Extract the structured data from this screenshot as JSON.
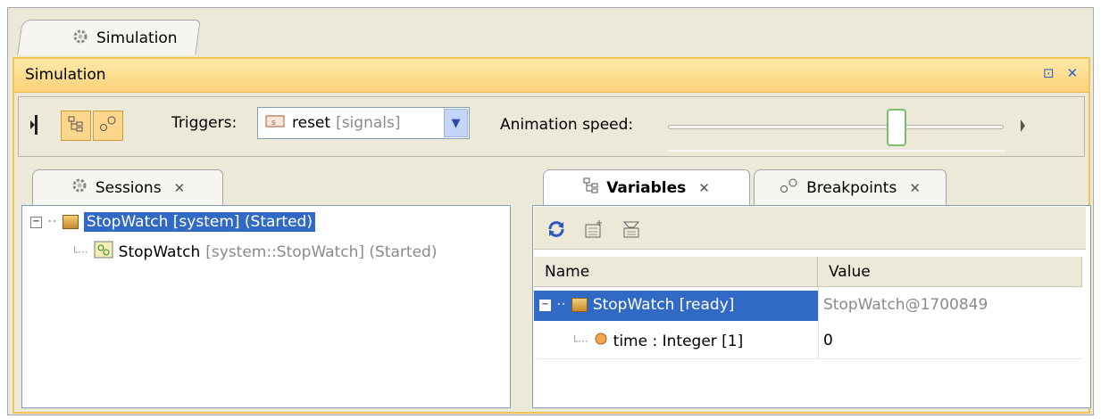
{
  "top_tab": {
    "label": "Simulation"
  },
  "window": {
    "title": "Simulation",
    "restore_glyph": "⊡",
    "close_glyph": "✕"
  },
  "toolbar": {
    "triggers_label": "Triggers:",
    "trigger_value": "reset",
    "trigger_scope": "[signals]",
    "speed_label": "Animation speed:",
    "speed_level": 0.68
  },
  "sessions": {
    "tab_label": "Sessions",
    "items": [
      {
        "name": "StopWatch [system] (Started)",
        "selected": true
      },
      {
        "name": "StopWatch",
        "detail": "[system::StopWatch] (Started)"
      }
    ]
  },
  "variables": {
    "tabs": [
      {
        "label": "Variables",
        "active": true
      },
      {
        "label": "Breakpoints",
        "active": false
      }
    ],
    "columns": [
      "Name",
      "Value"
    ],
    "rows": [
      {
        "name": "StopWatch [ready]",
        "value": "StopWatch@1700849",
        "selected": true
      },
      {
        "name": "time : Integer [1]",
        "value": "0"
      }
    ]
  },
  "colors": {
    "accent": "#f6c253",
    "selection": "#316ac5",
    "panel_border": "#7f9db9"
  }
}
